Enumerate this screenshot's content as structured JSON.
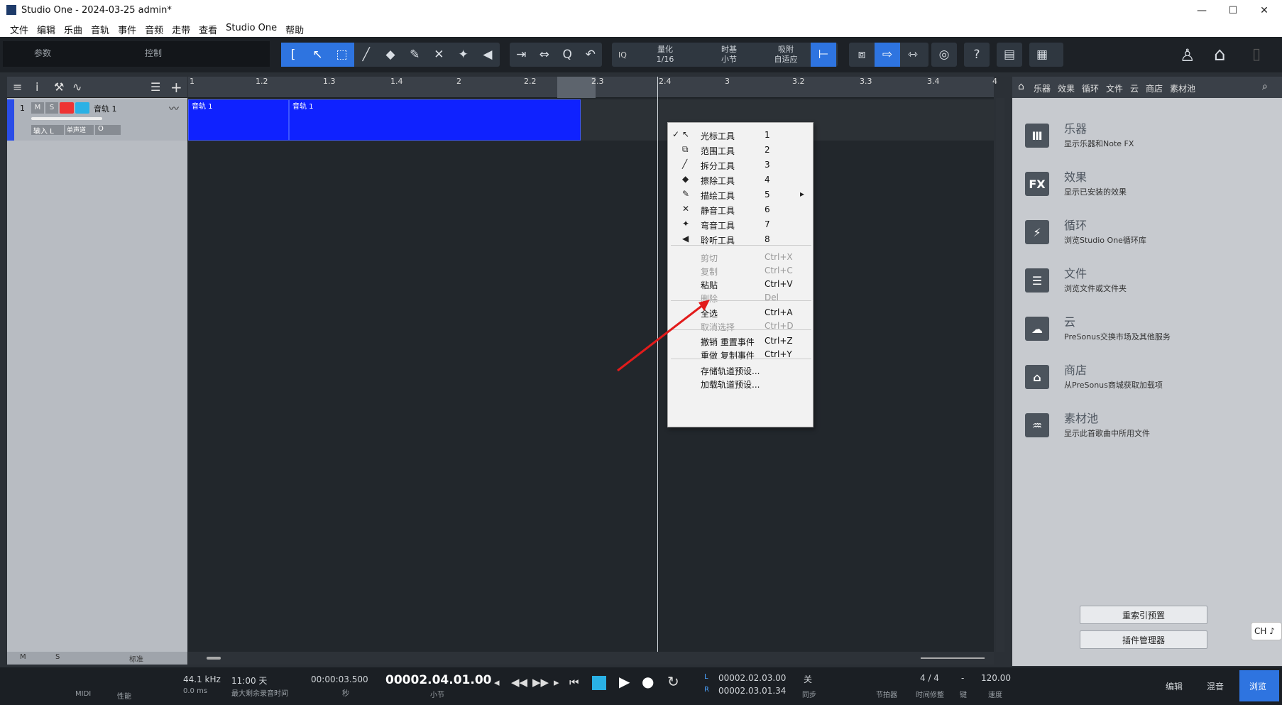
{
  "window": {
    "title": "Studio One - 2024-03-25 admin*",
    "min": "—",
    "max": "☐",
    "close": "✕"
  },
  "menu": [
    "文件",
    "编辑",
    "乐曲",
    "音轨",
    "事件",
    "音频",
    "走带",
    "查看",
    "Studio One",
    "帮助"
  ],
  "toolbar": {
    "params": "参数",
    "control": "控制",
    "quantize_label": "量化",
    "quantize_value": "1/16",
    "timebase_label": "时基",
    "timebase_value": "小节",
    "snap_label": "吸附",
    "snap_value": "自适应",
    "iq": "IQ",
    "help": "?"
  },
  "track": {
    "number": "1",
    "mute": "M",
    "solo": "S",
    "name": "音轨 1",
    "input": "输入 L",
    "mono": "单声道",
    "o": "O"
  },
  "ruler": [
    "1",
    "1.2",
    "1.3",
    "1.4",
    "2",
    "2.2",
    "2.3",
    "2.4",
    "3",
    "3.2",
    "3.3",
    "3.4",
    "4"
  ],
  "clips": [
    "音轨 1",
    "音轨 1"
  ],
  "context_menu": [
    {
      "icon": "↖",
      "label": "光标工具",
      "key": "1",
      "checked": "✓"
    },
    {
      "icon": "⧉",
      "label": "范围工具",
      "key": "2"
    },
    {
      "icon": "╱",
      "label": "拆分工具",
      "key": "3"
    },
    {
      "icon": "◆",
      "label": "擦除工具",
      "key": "4"
    },
    {
      "icon": "✎",
      "label": "描绘工具",
      "key": "5",
      "submenu": "▸"
    },
    {
      "icon": "✕",
      "label": "静音工具",
      "key": "6"
    },
    {
      "icon": "✦",
      "label": "弯音工具",
      "key": "7"
    },
    {
      "icon": "◀",
      "label": "聆听工具",
      "key": "8"
    },
    {
      "label": "剪切",
      "key": "Ctrl+X",
      "disabled": true
    },
    {
      "label": "复制",
      "key": "Ctrl+C",
      "disabled": true
    },
    {
      "label": "粘贴",
      "key": "Ctrl+V"
    },
    {
      "label": "删除",
      "key": "Del",
      "disabled": true
    },
    {
      "label": "全选",
      "key": "Ctrl+A"
    },
    {
      "label": "取消选择",
      "key": "Ctrl+D",
      "disabled": true
    },
    {
      "label": "撤销 重置事件",
      "key": "Ctrl+Z"
    },
    {
      "label": "重做 复制事件",
      "key": "Ctrl+Y"
    },
    {
      "label": "存储轨道预设..."
    },
    {
      "label": "加载轨道预设..."
    }
  ],
  "browser": {
    "tabs": [
      "乐器",
      "效果",
      "循环",
      "文件",
      "云",
      "商店",
      "素材池"
    ],
    "items": [
      {
        "icon": "Ⅲ",
        "title": "乐器",
        "sub": "显示乐器和Note FX"
      },
      {
        "icon": "FX",
        "title": "效果",
        "sub": "显示已安装的效果"
      },
      {
        "icon": "⚡",
        "title": "循环",
        "sub": "浏览Studio One循环库"
      },
      {
        "icon": "☰",
        "title": "文件",
        "sub": "浏览文件或文件夹"
      },
      {
        "icon": "☁",
        "title": "云",
        "sub": "PreSonus交换市场及其他服务"
      },
      {
        "icon": "⌂",
        "title": "商店",
        "sub": "从PreSonus商城获取加载项"
      },
      {
        "icon": "♒",
        "title": "素材池",
        "sub": "显示此首歌曲中所用文件"
      }
    ],
    "reindex": "重索引预置",
    "plugin_manager": "插件管理器"
  },
  "bottom_left": {
    "m": "M",
    "s": "S",
    "std": "标准"
  },
  "transport": {
    "midi": "MIDI",
    "perf": "性能",
    "rate": "44.1 kHz",
    "latency": "0.0 ms",
    "days": "11:00 天",
    "days_sub": "最大剩余录音时间",
    "time_sec": "00:00:03.500",
    "time_sec_unit": "秒",
    "position": "00002.04.01.00",
    "position_unit": "小节",
    "loop_l": "00002.02.03.00",
    "loop_r": "00002.03.01.34",
    "l": "L",
    "r": "R",
    "sync": "关",
    "sync_label": "同步",
    "metronome": "节拍器",
    "sig": "4 / 4",
    "sig_label": "时间修整",
    "key_label": "键",
    "key_val": "-",
    "tempo": "120.00",
    "tempo_label": "速度",
    "edit": "编辑",
    "mix": "混音",
    "browse": "浏览"
  },
  "ime": "CH ♪",
  "accent": "#2e74e0"
}
